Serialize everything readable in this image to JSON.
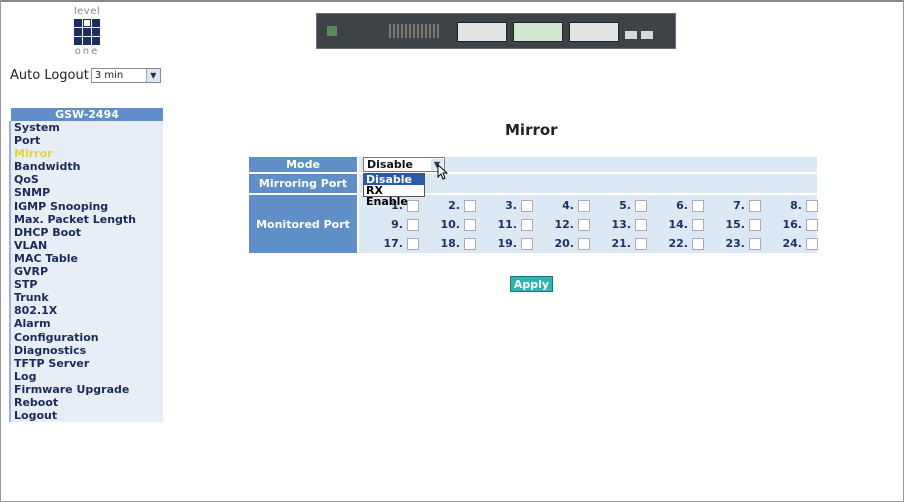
{
  "logo": {
    "top_text": "level",
    "bottom_text": "one"
  },
  "auto_logout": {
    "label": "Auto Logout",
    "value": "3 min"
  },
  "sidebar": {
    "header": "GSW-2494",
    "items": [
      {
        "label": "System",
        "active": false
      },
      {
        "label": "Port",
        "active": false
      },
      {
        "label": "Mirror",
        "active": true
      },
      {
        "label": "Bandwidth",
        "active": false
      },
      {
        "label": "QoS",
        "active": false
      },
      {
        "label": "SNMP",
        "active": false
      },
      {
        "label": "IGMP Snooping",
        "active": false
      },
      {
        "label": "Max. Packet Length",
        "active": false
      },
      {
        "label": "DHCP Boot",
        "active": false
      },
      {
        "label": "VLAN",
        "active": false
      },
      {
        "label": "MAC Table",
        "active": false
      },
      {
        "label": "GVRP",
        "active": false
      },
      {
        "label": "STP",
        "active": false
      },
      {
        "label": "Trunk",
        "active": false
      },
      {
        "label": "802.1X",
        "active": false
      },
      {
        "label": "Alarm",
        "active": false
      },
      {
        "label": "Configuration",
        "active": false
      },
      {
        "label": "Diagnostics",
        "active": false
      },
      {
        "label": "TFTP Server",
        "active": false
      },
      {
        "label": "Log",
        "active": false
      },
      {
        "label": "Firmware Upgrade",
        "active": false
      },
      {
        "label": "Reboot",
        "active": false
      },
      {
        "label": "Logout",
        "active": false
      }
    ]
  },
  "main": {
    "title": "Mirror",
    "mode_label": "Mode",
    "mode_value": "Disable",
    "mode_options": [
      "Disable",
      "RX Enable"
    ],
    "mirroring_port_label": "Mirroring Port",
    "monitored_port_label": "Monitored Port",
    "ports": [
      "1.",
      "2.",
      "3.",
      "4.",
      "5.",
      "6.",
      "7.",
      "8.",
      "9.",
      "10.",
      "11.",
      "12.",
      "13.",
      "14.",
      "15.",
      "16.",
      "17.",
      "18.",
      "19.",
      "20.",
      "21.",
      "22.",
      "23.",
      "24."
    ],
    "apply_label": "Apply"
  },
  "colors": {
    "accent": "#5f8fc6",
    "apply": "#2fb3b3",
    "active_menu": "#e8d23a"
  }
}
